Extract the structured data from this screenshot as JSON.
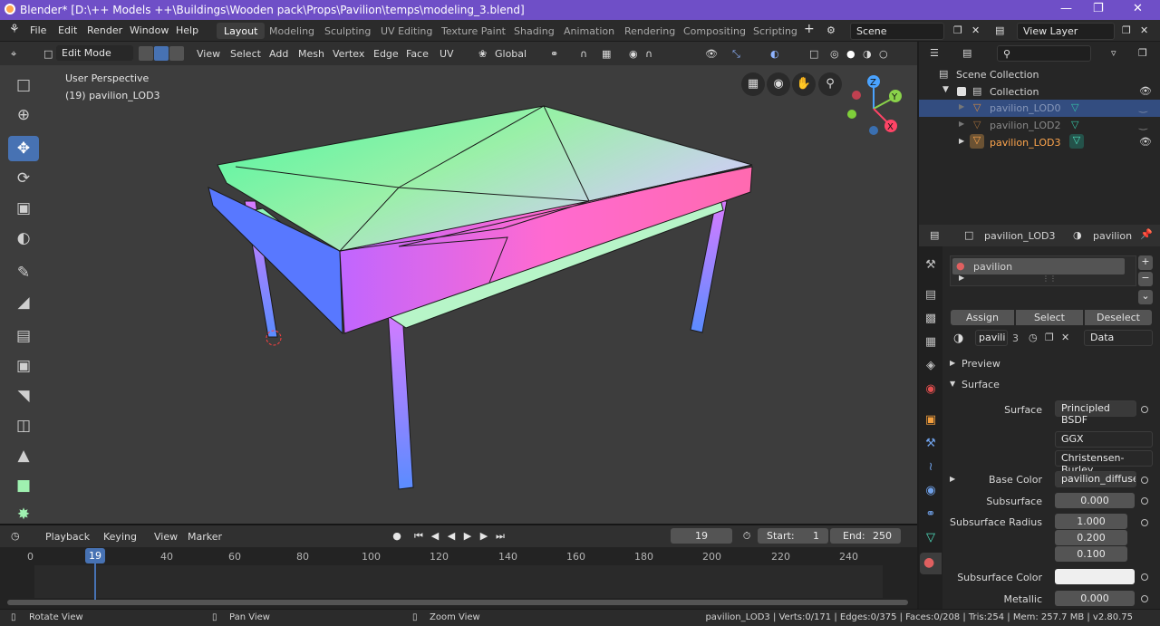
{
  "title_bar": {
    "title": "Blender* [D:\\++ Models ++\\Buildings\\Wooden pack\\Props\\Pavilion\\temps\\modeling_3.blend]"
  },
  "menu": [
    "File",
    "Edit",
    "Render",
    "Window",
    "Help"
  ],
  "workspaces": [
    "Layout",
    "Modeling",
    "Sculpting",
    "UV Editing",
    "Texture Paint",
    "Shading",
    "Animation",
    "Rendering",
    "Compositing",
    "Scripting"
  ],
  "active_workspace": "Layout",
  "scene": "Scene",
  "view_layer": "View Layer",
  "viewport_header": {
    "mode": "Edit Mode",
    "menus": [
      "View",
      "Select",
      "Add",
      "Mesh",
      "Vertex",
      "Edge",
      "Face",
      "UV"
    ],
    "orientation": "Global"
  },
  "viewport": {
    "perspective": "User Perspective",
    "object_info": "(19) pavilion_LOD3",
    "axes": {
      "x": "X",
      "y": "Y",
      "z": "Z"
    }
  },
  "outliner": {
    "scene_collection": "Scene Collection",
    "collection": "Collection",
    "objects": [
      "pavilion_LOD0",
      "pavilion_LOD2",
      "pavilion_LOD3"
    ]
  },
  "properties": {
    "object": "pavilion_LOD3",
    "material_name": "pavilion",
    "slot_name": "pavilion",
    "assign": "Assign",
    "select": "Select",
    "deselect": "Deselect",
    "mat_short": "pavili",
    "users": "3",
    "link": "Data",
    "preview": "Preview",
    "surface_section": "Surface",
    "rows": {
      "surface_label": "Surface",
      "surface_value": "Principled BSDF",
      "distribution": "GGX",
      "subsurface_method": "Christensen-Burley",
      "base_color_label": "Base Color",
      "base_color_value": "pavilion_diffuse...",
      "subsurface_label": "Subsurface",
      "subsurface_value": "0.000",
      "ss_radius_label": "Subsurface Radius",
      "ss_radius": [
        "1.000",
        "0.200",
        "0.100"
      ],
      "ss_color_label": "Subsurface Color",
      "metallic_label": "Metallic",
      "metallic_value": "0.000"
    }
  },
  "timeline": {
    "menus": [
      "Playback",
      "Keying",
      "View",
      "Marker"
    ],
    "current_frame": "19",
    "start_label": "Start:",
    "start": "1",
    "end_label": "End:",
    "end": "250",
    "ticks": [
      "0",
      "20",
      "40",
      "60",
      "80",
      "100",
      "120",
      "140",
      "160",
      "180",
      "200",
      "220",
      "240"
    ]
  },
  "status": {
    "rotate": "Rotate View",
    "pan": "Pan View",
    "zoom": "Zoom View",
    "info": "pavilion_LOD3 | Verts:0/171 | Edges:0/375 | Faces:0/208 | Tris:254 | Mem: 257.7 MB | v2.80.75"
  },
  "colors": {
    "accent": "#4772b3",
    "title": "#6f4fc7",
    "selected_object": "#ffa64d"
  }
}
